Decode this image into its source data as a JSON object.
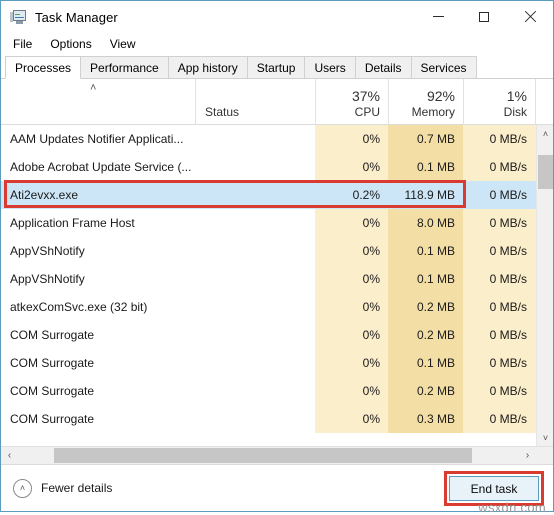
{
  "window": {
    "title": "Task Manager",
    "icon": "task-manager-icon",
    "controls": {
      "minimize": "—",
      "maximize": "☐",
      "close": "✕"
    }
  },
  "menubar": {
    "items": [
      "File",
      "Options",
      "View"
    ]
  },
  "tabs": [
    {
      "label": "Processes",
      "active": true
    },
    {
      "label": "Performance",
      "active": false
    },
    {
      "label": "App history",
      "active": false
    },
    {
      "label": "Startup",
      "active": false
    },
    {
      "label": "Users",
      "active": false
    },
    {
      "label": "Details",
      "active": false
    },
    {
      "label": "Services",
      "active": false
    }
  ],
  "columns": {
    "name": {
      "label": "",
      "sort_indicator": "˄"
    },
    "status": {
      "label": "Status",
      "percent": ""
    },
    "cpu": {
      "label": "CPU",
      "percent": "37%"
    },
    "memory": {
      "label": "Memory",
      "percent": "92%"
    },
    "disk": {
      "label": "Disk",
      "percent": "1%"
    }
  },
  "processes": [
    {
      "name": "AAM Updates Notifier Applicati...",
      "status": "",
      "cpu": "0%",
      "memory": "0.7 MB",
      "disk": "0 MB/s",
      "selected": false
    },
    {
      "name": "Adobe Acrobat Update Service (...",
      "status": "",
      "cpu": "0%",
      "memory": "0.1 MB",
      "disk": "0 MB/s",
      "selected": false
    },
    {
      "name": "Ati2evxx.exe",
      "status": "",
      "cpu": "0.2%",
      "memory": "118.9 MB",
      "disk": "0 MB/s",
      "selected": true
    },
    {
      "name": "Application Frame Host",
      "status": "",
      "cpu": "0%",
      "memory": "8.0 MB",
      "disk": "0 MB/s",
      "selected": false
    },
    {
      "name": "AppVShNotify",
      "status": "",
      "cpu": "0%",
      "memory": "0.1 MB",
      "disk": "0 MB/s",
      "selected": false
    },
    {
      "name": "AppVShNotify",
      "status": "",
      "cpu": "0%",
      "memory": "0.1 MB",
      "disk": "0 MB/s",
      "selected": false
    },
    {
      "name": "atkexComSvc.exe (32 bit)",
      "status": "",
      "cpu": "0%",
      "memory": "0.2 MB",
      "disk": "0 MB/s",
      "selected": false
    },
    {
      "name": "COM Surrogate",
      "status": "",
      "cpu": "0%",
      "memory": "0.2 MB",
      "disk": "0 MB/s",
      "selected": false
    },
    {
      "name": "COM Surrogate",
      "status": "",
      "cpu": "0%",
      "memory": "0.1 MB",
      "disk": "0 MB/s",
      "selected": false
    },
    {
      "name": "COM Surrogate",
      "status": "",
      "cpu": "0%",
      "memory": "0.2 MB",
      "disk": "0 MB/s",
      "selected": false
    },
    {
      "name": "COM Surrogate",
      "status": "",
      "cpu": "0%",
      "memory": "0.3 MB",
      "disk": "0 MB/s",
      "selected": false
    }
  ],
  "scrollbars": {
    "vertical": {
      "up_arrow": "˄",
      "down_arrow": "˅"
    },
    "horizontal": {
      "left_arrow": "‹",
      "right_arrow": "›"
    }
  },
  "footer": {
    "fewer_details_label": "Fewer details",
    "fewer_details_icon": "˄",
    "end_task_label": "End task"
  },
  "watermark": "wsxdn.com",
  "colors": {
    "window_border": "#5b9bbf",
    "selection": "#cde6f7",
    "annotation_red": "#d93b30",
    "cpu_column": "#fbeecb",
    "memory_column": "#f3dfa6",
    "disk_column": "#fbeecb",
    "button_face": "#e8f2f9"
  }
}
